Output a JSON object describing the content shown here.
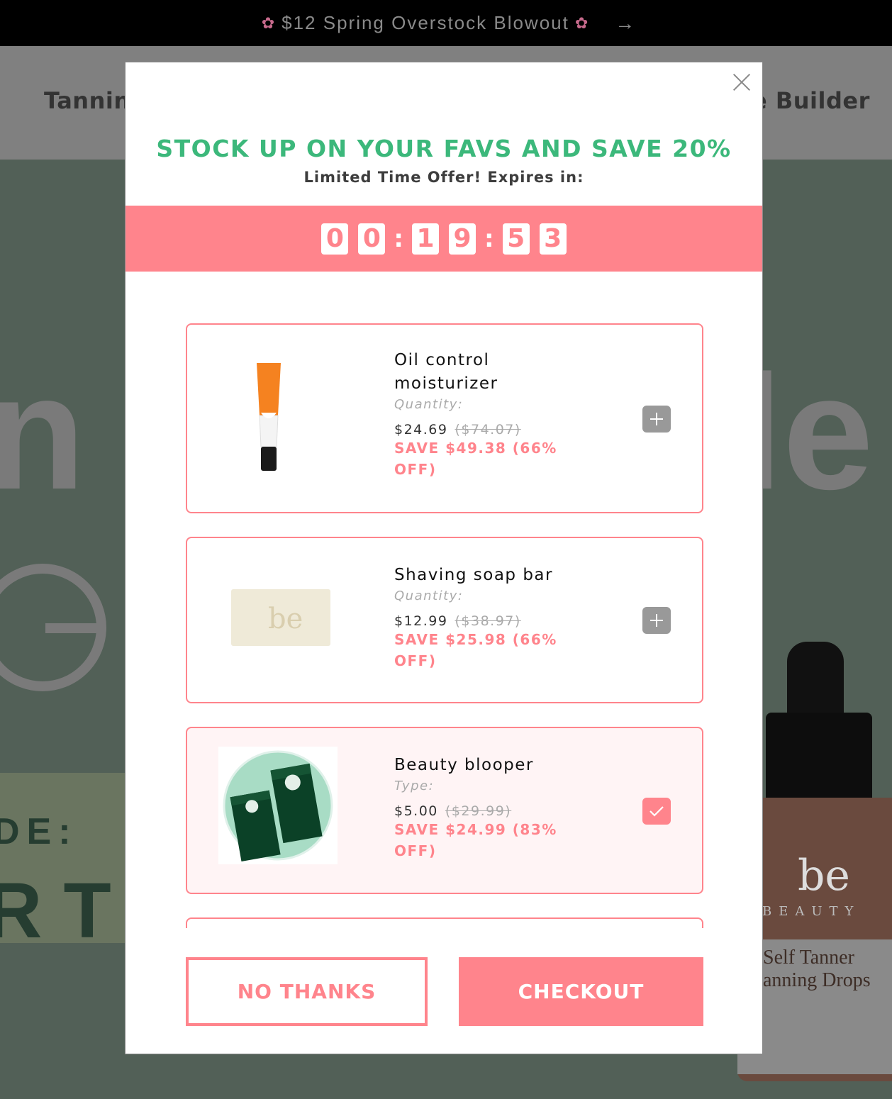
{
  "announcement": {
    "text": "$12 Spring Overstock Blowout",
    "left_icon": "cherry-blossom-icon",
    "right_icon": "cherry-blossom-icon",
    "arrow_icon": "arrow-right-icon",
    "flower_glyph": "✿",
    "arrow_glyph": "→"
  },
  "nav": {
    "left_item": "Tanning",
    "right_item": "e Builder"
  },
  "hero": {
    "fragment_1": "n",
    "fragment_2": "le",
    "fragment_3": "DE:",
    "fragment_4": "RTI",
    "bottle": {
      "logo": "be",
      "brand": "BEAUTY",
      "name_line1": "Self Tanner",
      "name_line2": "anning Drops"
    }
  },
  "modal": {
    "close_icon": "close-icon",
    "headline": "STOCK UP ON YOUR FAVS AND SAVE 20%",
    "subline": "Limited Time Offer! Expires in:",
    "timer": {
      "hours": [
        "0",
        "0"
      ],
      "minutes": [
        "1",
        "9"
      ],
      "seconds": [
        "5",
        "3"
      ],
      "separator": ":"
    },
    "products": [
      {
        "name_line1": "Oil control",
        "name_line2": "moisturizer",
        "option_label": "Quantity:",
        "price": "$24.69",
        "original_price": "($74.07)",
        "save_line1": "SAVE $49.38 (66%",
        "save_line2": "OFF)",
        "selected": false,
        "action_icon": "plus-icon"
      },
      {
        "name_line1": "Shaving soap bar",
        "option_label": "Quantity:",
        "price": "$12.99",
        "original_price": "($38.97)",
        "save_line1": "SAVE $25.98 (66%",
        "save_line2": "OFF)",
        "selected": false,
        "action_icon": "plus-icon"
      },
      {
        "name_line1": "Beauty blooper",
        "option_label": "Type:",
        "price": "$5.00",
        "original_price": "($29.99)",
        "save_line1": "SAVE $24.99 (83%",
        "save_line2": "OFF)",
        "selected": true,
        "action_icon": "checkmark-icon"
      }
    ],
    "no_thanks_label": "NO THANKS",
    "checkout_label": "CHECKOUT"
  },
  "colors": {
    "accent_pink": "#ff848c",
    "headline_green": "#3cb87b",
    "selected_bg": "#fff4f5",
    "add_button_gray": "#999999"
  }
}
